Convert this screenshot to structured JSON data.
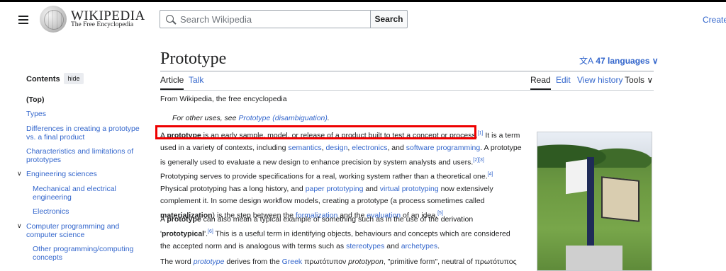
{
  "header": {
    "wordmark": "WIKIPEDIA",
    "tagline": "The Free Encyclopedia",
    "search_placeholder": "Search Wikipedia",
    "search_button": "Search",
    "create_account": "Create"
  },
  "article": {
    "title": "Prototype",
    "languages": "47 languages",
    "tabs": {
      "article": "Article",
      "talk": "Talk",
      "read": "Read",
      "edit": "Edit",
      "view_history": "View history",
      "tools": "Tools"
    },
    "from": "From Wikipedia, the free encyclopedia",
    "hatnote_prefix": "For other uses, see ",
    "hatnote_link": "Prototype (disambiguation)",
    "hatnote_suffix": ".",
    "p1": {
      "a": "A ",
      "b": "prototype",
      "c": " is an early sample, model, or release of a product built to test a concept or process.",
      "ref1": "[1]",
      "d": " It is a term used in a variety of contexts, including ",
      "l1": "semantics",
      "e": ", ",
      "l2": "design",
      "f": ", ",
      "l3": "electronics",
      "g": ", and ",
      "l4": "software programming",
      "h": ". A prototype is generally used to evaluate a new design to enhance precision by system analysts and users.",
      "ref23": "[2][3]",
      "i": " Prototyping serves to provide specifications for a real, working system rather than a theoretical one.",
      "ref4": "[4]",
      "j": " Physical prototyping has a long history, and ",
      "l5": "paper prototyping",
      "k": " and ",
      "l6": "virtual prototyping",
      "m": " now extensively complement it. In some design workflow models, creating a prototype (a process sometimes called ",
      "n": "materialization",
      "o": ") is the step between the ",
      "l7": "formalization",
      "p": " and the ",
      "l8": "evaluation",
      "q": " of an idea.",
      "ref5": "[5]"
    },
    "p2": {
      "a": "A ",
      "b": "prototype",
      "c": " can also mean a typical example of something such as in the use of the derivation '",
      "d": "prototypical",
      "e": "'.",
      "ref6": "[6]",
      "f": " This is a useful term in identifying objects, behaviours and concepts which are considered the accepted norm and is analogous with terms such as ",
      "l1": "stereotypes",
      "g": " and ",
      "l2": "archetypes",
      "h": "."
    },
    "p3": {
      "a": "The word ",
      "l1": "prototype",
      "b": " derives from the ",
      "l2": "Greek",
      "c": " πρωτότυπον ",
      "d": "prototypon",
      "e": ", \"primitive form\", neutral of πρωτότυπος"
    }
  },
  "toc": {
    "heading": "Contents",
    "hide": "hide",
    "items": [
      "(Top)",
      "Types",
      "Differences in creating a prototype vs. a final product",
      "Characteristics and limitations of prototypes",
      "Engineering sciences",
      "Mechanical and electrical engineering",
      "Electronics",
      "Computer programming and computer science",
      "Other programming/computing concepts"
    ]
  },
  "colors": {
    "link": "#3366cc",
    "text": "#202122",
    "highlight": "#ee0000"
  },
  "icons": [
    "menu-icon",
    "wikipedia-globe-logo",
    "search-icon",
    "translate-icon",
    "chevron-down-icon"
  ]
}
